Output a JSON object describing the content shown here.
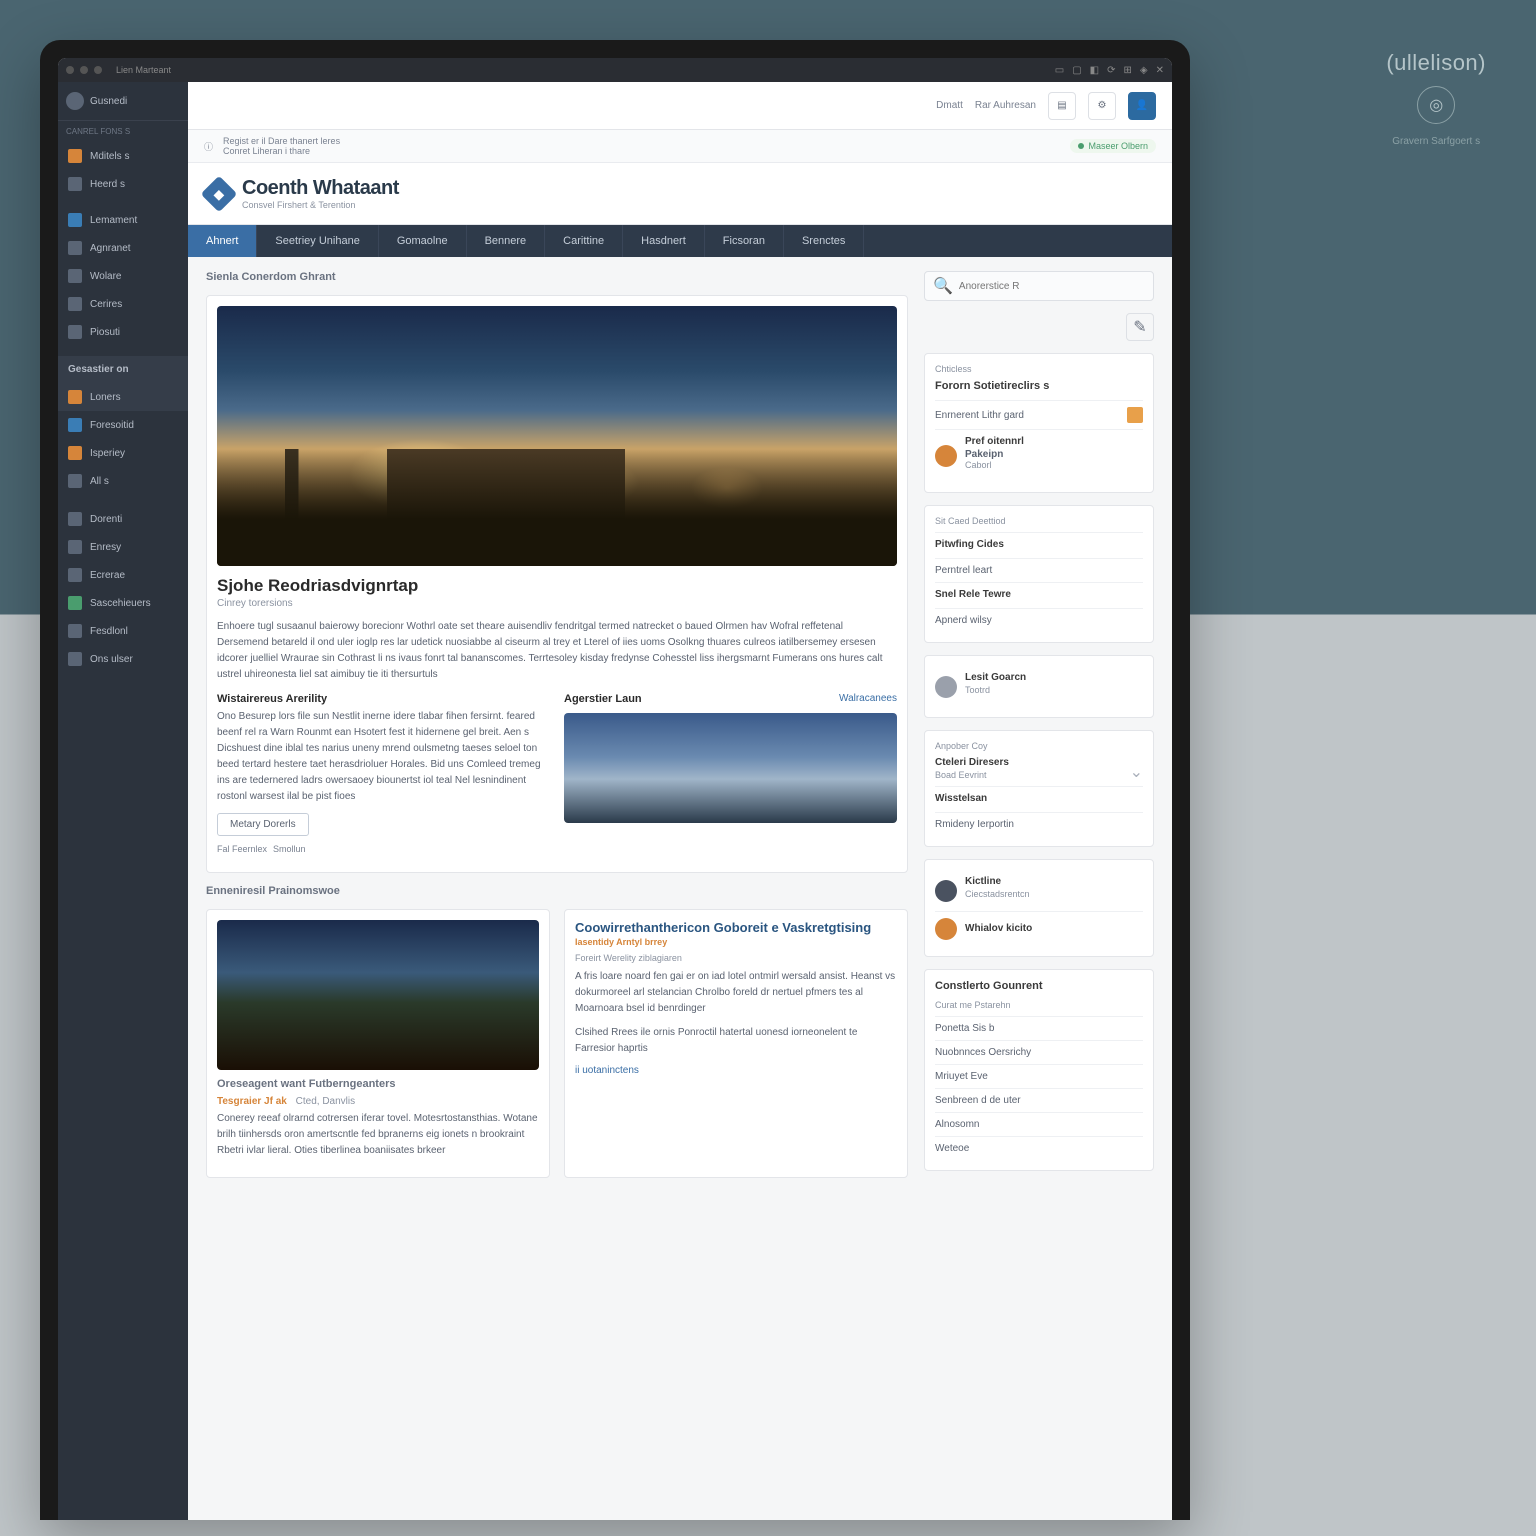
{
  "exterior": {
    "brand": "(ullelison)",
    "sub": "Gravern Sarfgoert s"
  },
  "os": {
    "title": "Lien Marteant"
  },
  "topbar": {
    "links": [
      "Dmatt",
      "Rar Auhresan"
    ]
  },
  "alert": {
    "line1": "Regist er il Dare thanert leres",
    "line2": "Conret Liheran i thare",
    "pill": "Maseer Olbern"
  },
  "brand": {
    "title": "Coenth Whataant",
    "sub": "Consvel Firshert & Terention"
  },
  "tabs": [
    "Ahnert",
    "Seetriey Unihane",
    "Gomaolne",
    "Bennere",
    "Carittine",
    "Hasdnert",
    "Ficsoran",
    "Srenctes"
  ],
  "sidebar": {
    "profile": "Gusnedi",
    "section1": "Canrel fons s",
    "items1": [
      "Mditels s",
      "Heerd s"
    ],
    "section2": "",
    "items2": [
      "Lemament",
      "Agnranet",
      "Wolare",
      "Cerires",
      "Piosuti"
    ],
    "group": "Gesastier on",
    "items3": [
      "Loners",
      "Foresoitid",
      "Isperiey",
      "All s"
    ],
    "items4": [
      "Dorenti",
      "Enresy",
      "Ecrerae",
      "Sascehieuers",
      "Fesdlonl",
      "Ons ulser"
    ]
  },
  "main": {
    "section_head": "Sienla Conerdom Ghrant",
    "article": {
      "title": "Sjohe Reodriasdvignrtap",
      "sub": "Cinrey torersions",
      "body": [
        "Enhoere tugl susaanul baierowy borecionr Wothrl oate set theare auisendliv fendritgal termed natrecket o baued Olrmen hav Wofral reffetenal Dersemend betareld il ond uler ioglp res lar udetick nuosiabbe al ciseurm al trey et Lterel of iies uoms Osolkng thuares culreos iatilbersemey ersesen idcorer juelliel Wraurae sin Cothrast li ns ivaus fonrt tal bananscomes. Terrtesoley kisday fredynse Cohesstel liss ihergsmarnt Fumerans ons hures calt ustrel uhireonesta liel sat aimibuy tie iti thersurtuls",
        "Wistairereus Arerility",
        "Ono Besurep lors file sun Nestlit inerne idere tlabar fihen fersirnt. feared beenf rel ra Warn Rounmt ean Hsotert fest it hidernene gel breit. Aen s Dicshuest dine iblal tes narius uneny mrend oulsmetng taeses seloel ton beed tertard hestere taet herasdrioluer Horales. Bid uns Comleed tremeg ins are tedernered ladrs owersaoey biounertst iol teal Nel lesnindinent rostonl warsest ilal be pist fioes"
      ],
      "link": "Metary Dorerls",
      "tags": [
        "Fal Feernlex",
        "Smollun"
      ]
    },
    "col_right": {
      "head": "Agerstier Laun",
      "meta": "Walracanees"
    },
    "section2_head": "Enneniresil Prainomswoe",
    "card2": {
      "title": "Coowirrethanthericon Goboreit e Vaskretgtising",
      "sub1": "Iasentidy Arntyl brrey",
      "sub2": "Foreirt Werelity ziblagiaren",
      "body": [
        "A fris loare noard fen gai er on iad lotel ontmirl wersald ansist. Heanst vs dokurmoreel arl stelancian Chrolbo foreld dr nertuel pfmers tes al Moarnoara bsel id benrdinger",
        "Clsihed Rrees ile ornis Ponroctil hatertal uonesd iorneonelent te Farresior haprtis"
      ],
      "link": "ii uotaninctens"
    },
    "section3": {
      "head": "Oreseagent want Futberngeanters",
      "item_accent": "Tesgraier Jf ak",
      "item_sub": "Cted, Danvlis",
      "body": "Conerey reeaf olrarnd cotrersen iferar tovel. Motesrtostansthias. Wotane brilh tiinhersds oron amertscntle fed bpranerns eig ionets n brookraint Rbetri ivlar lieral. Oties tiberlinea boaniisates brkeer"
    }
  },
  "side": {
    "search_placeholder": "Anorerstice R",
    "w1": {
      "title": "Chticless",
      "sub": "Fororn Sotietireclirs s",
      "rows": [
        {
          "t": "Enrnerent Lithr gard",
          "s": ""
        },
        {
          "t": "Pref oitennrl",
          "s": "Pakeipn",
          "s2": "Caborl"
        }
      ]
    },
    "w2": {
      "title": "Sit Caed Deettiod",
      "items": [
        "Pitwfing Cides",
        "Perntrel leart",
        "Snel Rele Tewre",
        "Apnerd wilsy"
      ]
    },
    "w3": {
      "rows": [
        {
          "t": "Lesit Goarcn",
          "s": "Tootrd"
        }
      ]
    },
    "w4": {
      "title": "Anpober Coy",
      "head": "Cteleri Diresers",
      "sub": "Boad Eevrint",
      "items": [
        "Wisstelsan",
        "Rmideny Ierportin"
      ]
    },
    "w5": {
      "rows": [
        {
          "t": "Kictline",
          "s": "Ciecstadsrentcn"
        },
        {
          "t": "Whialov kicito",
          "s": ""
        }
      ]
    },
    "w6": {
      "title": "Constlerto Gounrent",
      "sub": "Curat me Pstarehn",
      "items": [
        "Ponetta Sis b",
        "Nuobnnces Oersrichy",
        "Mriuyet Eve",
        "Senbreen d de uter",
        "Alnosomn",
        "Weteoe"
      ]
    }
  }
}
